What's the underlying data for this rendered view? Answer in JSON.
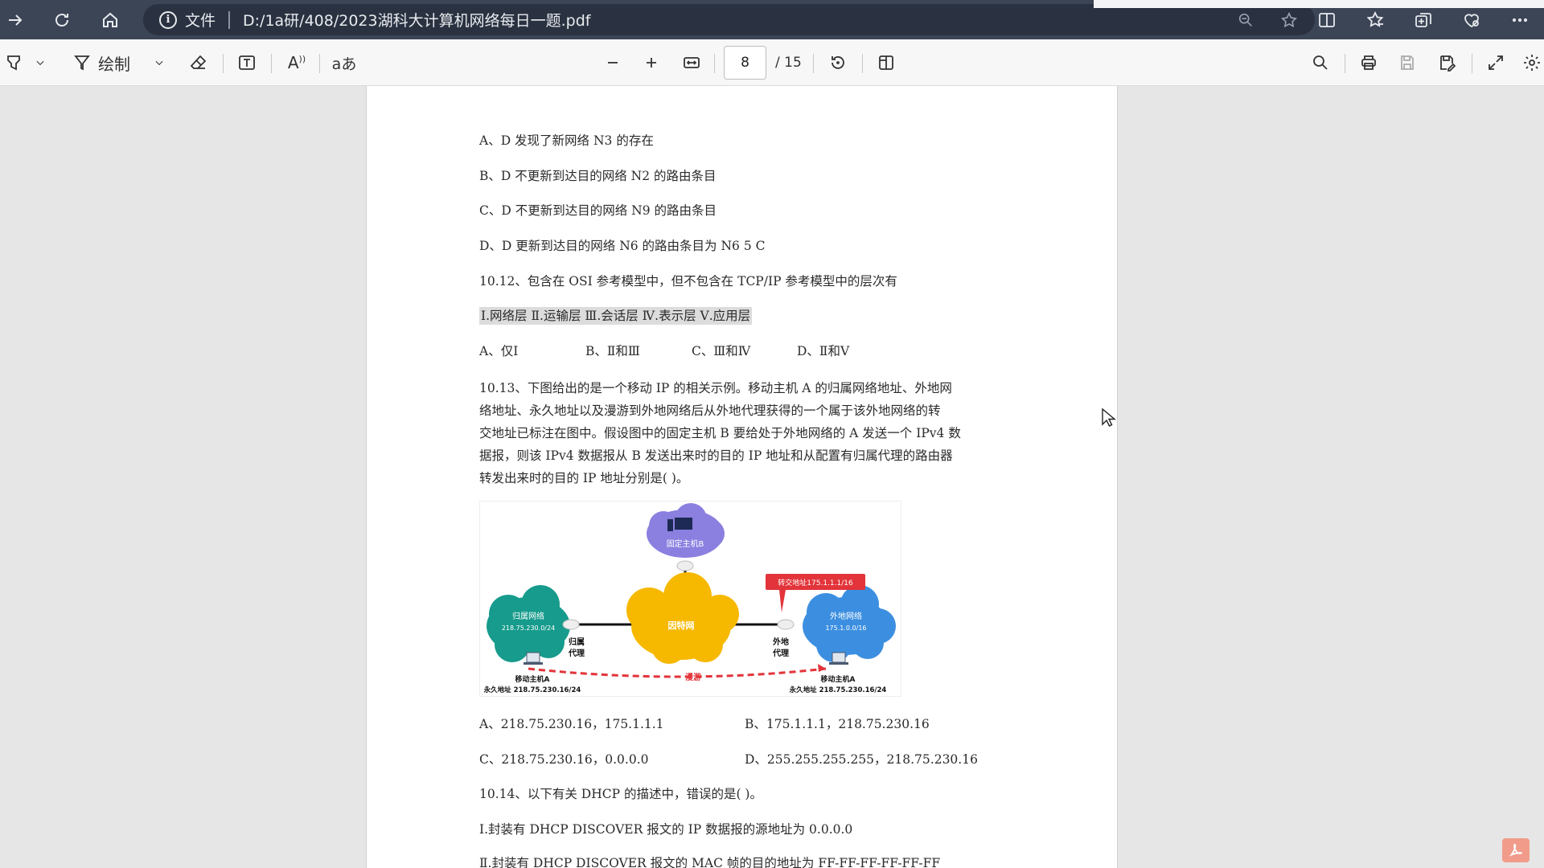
{
  "titlebar": {
    "scheme_label": "文件",
    "url": "D:/1a研/408/2023湖科大计算机网络每日一题.pdf"
  },
  "toolbar": {
    "draw_label": "绘制",
    "read_aloud_label": "A",
    "translate_label": "aあ",
    "current_page": "8",
    "total_pages": "/ 15"
  },
  "document": {
    "lines": {
      "q11_a": "A、D 发现了新网络 N3 的存在",
      "q11_b": "B、D 不更新到达目的网络 N2 的路由条目",
      "q11_c": "C、D 不更新到达目的网络 N9 的路由条目",
      "q11_d": "D、D 更新到达目的网络 N6 的路由条目为 N6   5   C",
      "q12": "10.12、包含在 OSI 参考模型中，但不包含在 TCP/IP 参考模型中的层次有",
      "q12_items": "Ⅰ.网络层   Ⅱ.运输层   Ⅲ.会话层   Ⅳ.表示层   Ⅴ.应用层",
      "q12_a": "A、仅Ⅰ",
      "q12_b": "B、Ⅱ和Ⅲ",
      "q12_c": "C、Ⅲ和Ⅳ",
      "q12_d": "D、Ⅱ和Ⅴ",
      "q13_1": "10.13、下图给出的是一个移动 IP 的相关示例。移动主机 A 的归属网络地址、外地网",
      "q13_2": "络地址、永久地址以及漫游到外地网络后从外地代理获得的一个属于该外地网络的转",
      "q13_3": "交地址已标注在图中。假设图中的固定主机 B 要给处于外地网络的 A 发送一个 IPv4 数",
      "q13_4": "据报，则该 IPv4 数据报从 B 发送出来时的目的 IP 地址和从配置有归属代理的路由器",
      "q13_5": "转发出来时的目的 IP 地址分别是(      )。",
      "q13_a": "A、218.75.230.16，175.1.1.1",
      "q13_b": "B、175.1.1.1，218.75.230.16",
      "q13_c": "C、218.75.230.16，0.0.0.0",
      "q13_d": "D、255.255.255.255，218.75.230.16",
      "q14": "10.14、以下有关 DHCP 的描述中，错误的是(        )。",
      "q14_1": "Ⅰ.封装有 DHCP DISCOVER 报文的 IP 数据报的源地址为 0.0.0.0",
      "q14_2": "Ⅱ.封装有 DHCP DISCOVER 报文的 MAC 帧的目的地址为 FF-FF-FF-FF-FF-FF"
    },
    "diagram": {
      "fixed_host": "固定主机B",
      "internet": "因特网",
      "home_net": "归属网络",
      "home_net_addr": "218.75.230.0/24",
      "foreign_net": "外地网络",
      "foreign_net_addr": "175.1.0.0/16",
      "care_of": "转交地址175.1.1.1/16",
      "home_agent": "归属",
      "home_agent2": "代理",
      "foreign_agent": "外地",
      "foreign_agent2": "代理",
      "roam": "漫游",
      "host_left": "移动主机A",
      "perm_left": "永久地址 218.75.230.16/24",
      "host_right": "移动主机A",
      "perm_right": "永久地址 218.75.230.16/24",
      "colors": {
        "home": "#169b8c",
        "internet": "#f7b800",
        "foreign": "#3c8fe0",
        "fixed": "#8b7fe0",
        "callout": "#e2343a"
      }
    }
  }
}
